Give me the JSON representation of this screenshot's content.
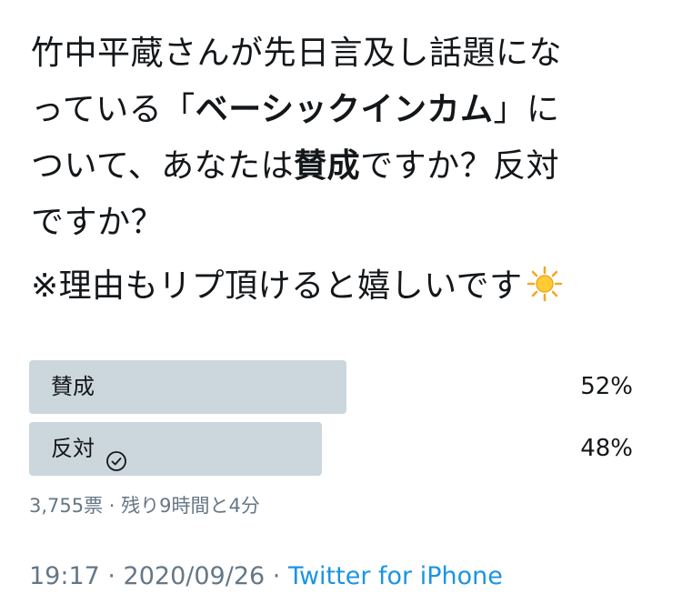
{
  "tweet": {
    "line1": "竹中平蔵さんが先日言及し話題にな",
    "line2_pre": "っている「",
    "line2_bold": "ベーシックインカム",
    "line2_post": "」に",
    "line3_pre": "ついて、あなたは",
    "line3_bold": "賛成",
    "line3_post": "ですか？反対",
    "line4": "ですか？",
    "note": "※理由もリプ頂けると嬉しいです",
    "emoji_icon": "sun-emoji-icon"
  },
  "poll": {
    "options": [
      {
        "label": "賛成",
        "percent_text": "52%",
        "share": 0.52,
        "voted": false
      },
      {
        "label": "反対",
        "percent_text": "48%",
        "share": 0.48,
        "voted": true
      }
    ],
    "meta": "3,755票 · 残り9時間と4分",
    "bar_color": "#ccd6dd"
  },
  "footer": {
    "timestamp": "19:17 · 2020/09/26",
    "separator": " · ",
    "source": "Twitter for iPhone",
    "source_color": "#1b95e0"
  }
}
